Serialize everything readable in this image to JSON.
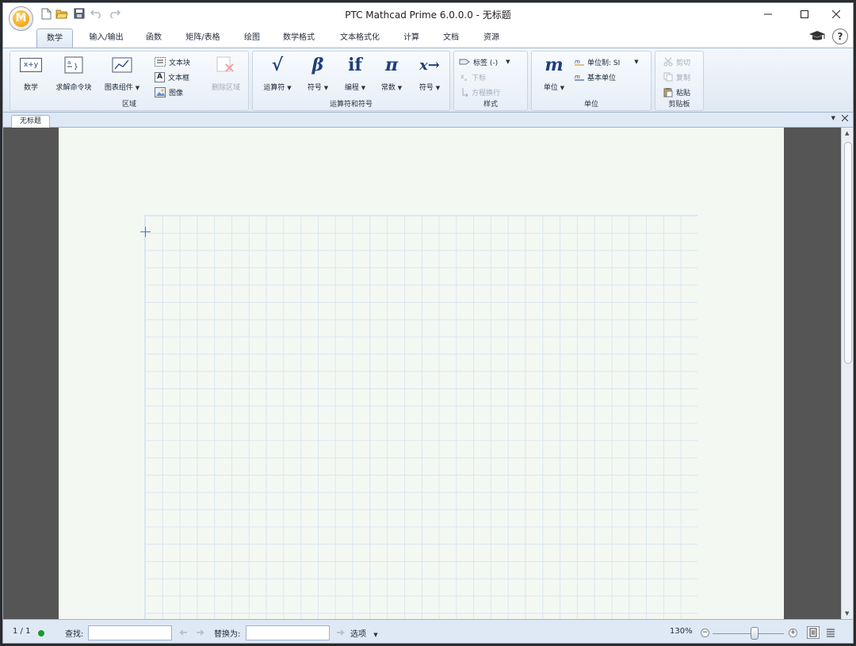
{
  "window": {
    "title": "PTC Mathcad Prime 6.0.0.0 - 无标题",
    "logo_letter": "M"
  },
  "tabs": [
    {
      "label": "数学",
      "active": true
    },
    {
      "label": "输入/输出"
    },
    {
      "label": "函数"
    },
    {
      "label": "矩阵/表格"
    },
    {
      "label": "绘图"
    },
    {
      "label": "数学格式"
    },
    {
      "label": "文本格式化"
    },
    {
      "label": "计算"
    },
    {
      "label": "文档"
    },
    {
      "label": "资源"
    }
  ],
  "help_label": "?",
  "ribbon": {
    "regions": {
      "label": "区域",
      "math": {
        "label": "数学",
        "icon_text": "x+y"
      },
      "solve_block": {
        "label": "求解命令块"
      },
      "chart_component": {
        "label": "图表组件"
      },
      "text_block": {
        "label": "文本块"
      },
      "text_box": {
        "label": "文本框",
        "icon_text": "A"
      },
      "image": {
        "label": "图像"
      },
      "delete_region": {
        "label": "删除区域"
      }
    },
    "operators": {
      "label": "运算符和符号",
      "operators_btn": {
        "label": "运算符",
        "glyph": "√"
      },
      "symbols_btn": {
        "label": "符号",
        "glyph": "β"
      },
      "programming_btn": {
        "label": "编程",
        "glyph": "if"
      },
      "constants_btn": {
        "label": "常数",
        "glyph": "π"
      },
      "vector_symbols_btn": {
        "label": "符号",
        "glyph": "x→"
      }
    },
    "style": {
      "label": "样式",
      "label_select": "标签 (-)",
      "subscript": "下标",
      "equation_wrap": "方程换行"
    },
    "units": {
      "label": "单位",
      "units_btn": {
        "label": "单位",
        "glyph": "m"
      },
      "unit_system": "单位制: SI",
      "base_units": "基本单位"
    },
    "clipboard": {
      "label": "剪贴板",
      "cut": "剪切",
      "copy": "复制",
      "paste": "粘贴"
    }
  },
  "document": {
    "tab_label": "无标题"
  },
  "statusbar": {
    "page_indicator": "1 / 1",
    "find_label": "查找:",
    "find_value": "",
    "replace_label": "替换为:",
    "replace_value": "",
    "options_label": "选项",
    "zoom": "130%"
  },
  "colors": {
    "accent": "#1c3f7a",
    "ribbon_bg": "#dfe9f5",
    "page_bg": "#f4f8f3",
    "grid_line": "#d9e6f2",
    "status_ok": "#1a9a2a"
  }
}
